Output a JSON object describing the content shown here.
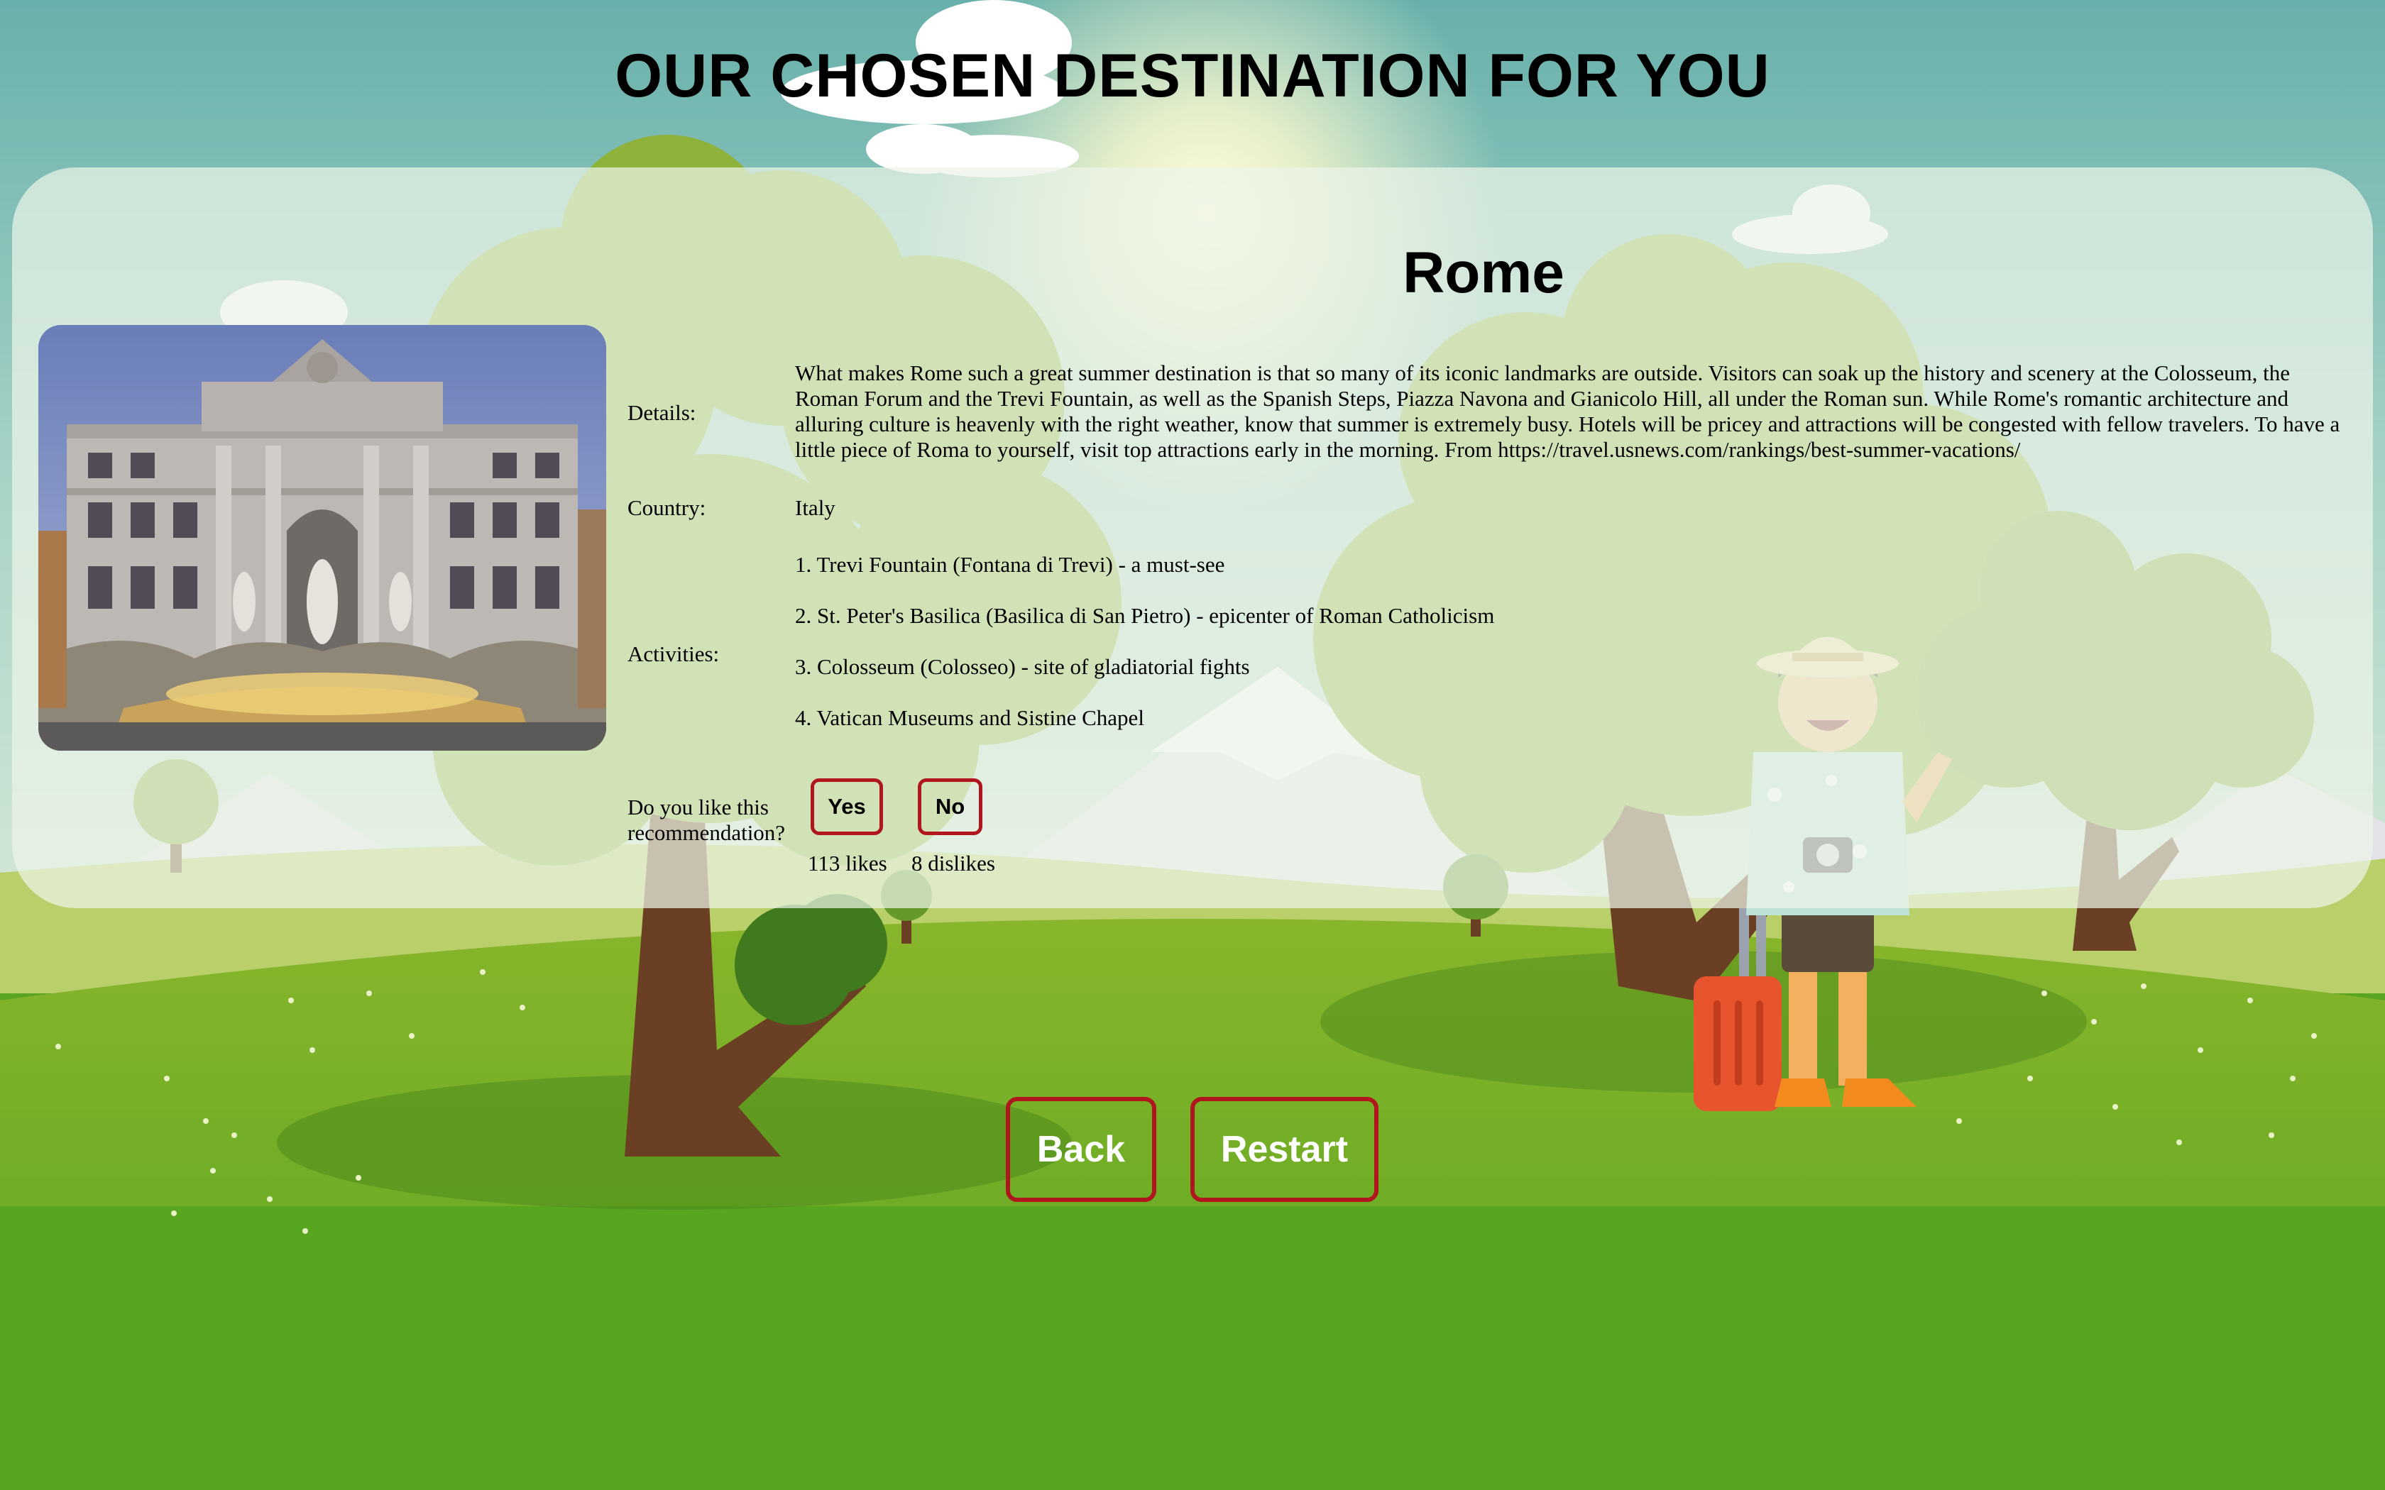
{
  "header": {
    "title": "OUR CHOSEN DESTINATION FOR YOU"
  },
  "destination": {
    "name": "Rome",
    "labels": {
      "details": "Details:",
      "country": "Country:",
      "activities": "Activities:",
      "feedback": "Do you like this recommendation?"
    },
    "details": "What makes Rome such a great summer destination is that so many of its iconic landmarks are outside. Visitors can soak up the history and scenery at the Colosseum, the Roman Forum and the Trevi Fountain, as well as the Spanish Steps, Piazza Navona and Gianicolo Hill, all under the Roman sun. While Rome's romantic architecture and alluring culture is heavenly with the right weather, know that summer is extremely busy. Hotels will be pricey and attractions will be congested with fellow travelers. To have a little piece of Roma to yourself, visit top attractions early in the morning. From https://travel.usnews.com/rankings/best-summer-vacations/",
    "country": "Italy",
    "activities": [
      "1. Trevi Fountain (Fontana di Trevi) - a must-see",
      "2. St. Peter's Basilica (Basilica di San Pietro) - epicenter of Roman Catholicism",
      "3. Colosseum (Colosseo) - site of gladiatorial fights",
      "4. Vatican Museums and Sistine Chapel"
    ]
  },
  "feedback": {
    "yes_label": "Yes",
    "no_label": "No",
    "likes": "113 likes",
    "dislikes": "8 dislikes"
  },
  "navigation": {
    "back_label": "Back",
    "restart_label": "Restart"
  },
  "colors": {
    "sky": "#68b0ab",
    "grass": "#5aa623",
    "button_border": "#b0161e",
    "card": "#ecf4e8"
  }
}
